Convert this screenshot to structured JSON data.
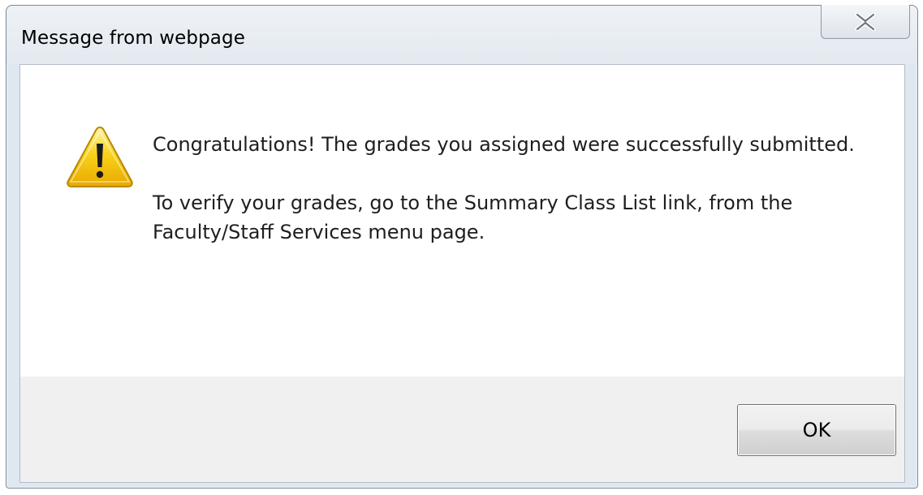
{
  "dialog": {
    "title": "Message from webpage",
    "icon": "warning-icon",
    "message_lines": [
      "Congratulations! The grades you assigned were successfully submitted.",
      "To verify your grades, go to the Summary Class List link, from the Faculty/Staff Services menu page."
    ],
    "ok_label": "OK",
    "close_icon": "close-icon"
  },
  "colors": {
    "footer_bg": "#f0f0f0",
    "warning_yellow": "#f5c400",
    "frame": "#dfe7f0"
  }
}
